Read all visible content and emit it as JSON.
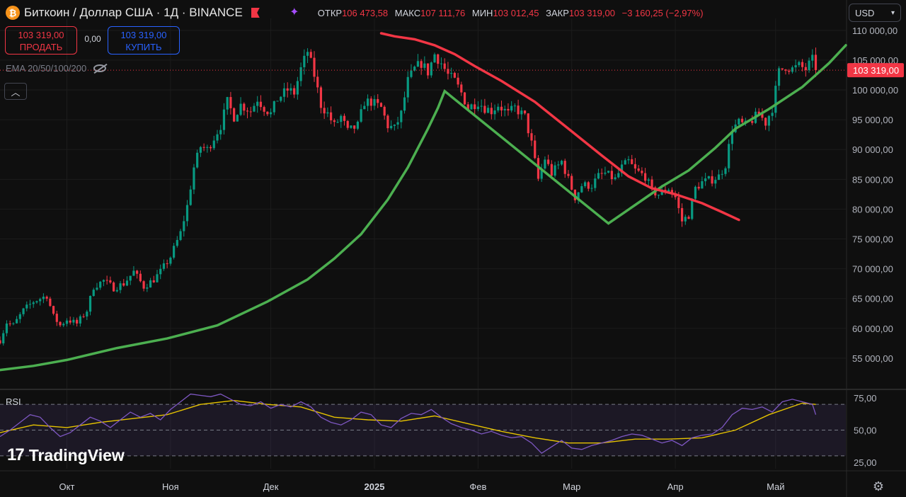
{
  "header": {
    "coin_letter": "₿",
    "title": "Биткоин / Доллар США · 1Д · BINANCE",
    "open_label": "ОТКР",
    "open_value": "106 473,58",
    "high_label": "МАКС",
    "high_value": "107 111,76",
    "low_label": "МИН",
    "low_value": "103 012,45",
    "close_label": "ЗАКР",
    "close_value": "103 319,00",
    "change_value": "−3 160,25 (−2,97%)",
    "currency": "USD"
  },
  "trade": {
    "sell_price": "103 319,00",
    "sell_label": "ПРОДАТЬ",
    "spread": "0,00",
    "buy_price": "103 319,00",
    "buy_label": "КУПИТЬ"
  },
  "indicator_label": "EMA 20/50/100/200",
  "rsi_label": "RSI",
  "logo_text": "TradingView",
  "colors": {
    "up": "#089981",
    "down": "#f23645",
    "ema_red": "#f23645",
    "ema_green": "#4caf50",
    "rsi": "#7e57c2",
    "rsi_ma": "#e6c300",
    "bg": "#0f0f0f"
  },
  "chart_data": {
    "type": "candlestick",
    "symbol": "BTCUSD",
    "y_axis": {
      "ticks": [
        55000,
        60000,
        65000,
        70000,
        75000,
        80000,
        85000,
        90000,
        95000,
        100000,
        105000,
        110000
      ],
      "tick_labels": [
        "55 000,00",
        "60 000,00",
        "65 000,00",
        "70 000,00",
        "75 000,00",
        "80 000,00",
        "85 000,00",
        "90 000,00",
        "95 000,00",
        "100 000,00",
        "105 000,00",
        "110 000,00"
      ],
      "range": [
        50000,
        112000
      ]
    },
    "x_axis": {
      "labels": [
        "Окт",
        "Ноя",
        "Дек",
        "2025",
        "Фев",
        "Мар",
        "Апр",
        "Май"
      ],
      "label_days": [
        0,
        31,
        61,
        92,
        123,
        151,
        182,
        212
      ],
      "range_days": [
        -20,
        233
      ],
      "first_day_date": "2024-10-01"
    },
    "last_price": 103319.0,
    "last_price_label": "103 319,00",
    "path_points": [
      [
        -20,
        58000
      ],
      [
        -18,
        61000
      ],
      [
        -16,
        60500
      ],
      [
        -13,
        63000
      ],
      [
        -10,
        64500
      ],
      [
        -6,
        65500
      ],
      [
        -4,
        62000
      ],
      [
        -2,
        60500
      ],
      [
        0,
        61500
      ],
      [
        3,
        60800
      ],
      [
        6,
        63000
      ],
      [
        8,
        67000
      ],
      [
        11,
        68000
      ],
      [
        14,
        66800
      ],
      [
        17,
        67500
      ],
      [
        20,
        69500
      ],
      [
        23,
        67000
      ],
      [
        26,
        68200
      ],
      [
        28,
        69500
      ],
      [
        31,
        72000
      ],
      [
        34,
        76000
      ],
      [
        36,
        80500
      ],
      [
        38,
        87000
      ],
      [
        40,
        90500
      ],
      [
        42,
        90000
      ],
      [
        44,
        92000
      ],
      [
        46,
        94000
      ],
      [
        48,
        98000
      ],
      [
        50,
        95500
      ],
      [
        52,
        97500
      ],
      [
        55,
        96500
      ],
      [
        57,
        98500
      ],
      [
        59,
        97000
      ],
      [
        61,
        96000
      ],
      [
        63,
        98500
      ],
      [
        66,
        100000
      ],
      [
        68,
        99500
      ],
      [
        70,
        103500
      ],
      [
        72,
        106500
      ],
      [
        74,
        102500
      ],
      [
        76,
        97500
      ],
      [
        78,
        96000
      ],
      [
        80,
        94000
      ],
      [
        82,
        95500
      ],
      [
        84,
        93000
      ],
      [
        87,
        94000
      ],
      [
        89,
        98000
      ],
      [
        91,
        98000
      ],
      [
        94,
        97000
      ],
      [
        96,
        94000
      ],
      [
        98,
        93500
      ],
      [
        100,
        96000
      ],
      [
        102,
        101500
      ],
      [
        104,
        103500
      ],
      [
        106,
        104500
      ],
      [
        108,
        103000
      ],
      [
        110,
        106000
      ],
      [
        112,
        104500
      ],
      [
        114,
        102500
      ],
      [
        116,
        101500
      ],
      [
        118,
        99500
      ],
      [
        120,
        97000
      ],
      [
        123,
        98000
      ],
      [
        125,
        97000
      ],
      [
        127,
        96500
      ],
      [
        129,
        97500
      ],
      [
        132,
        96000
      ],
      [
        134,
        97000
      ],
      [
        137,
        95500
      ],
      [
        139,
        91000
      ],
      [
        141,
        85000
      ],
      [
        143,
        88500
      ],
      [
        145,
        86000
      ],
      [
        148,
        88000
      ],
      [
        150,
        85000
      ],
      [
        152,
        82000
      ],
      [
        154,
        84000
      ],
      [
        157,
        84000
      ],
      [
        159,
        85500
      ],
      [
        161,
        86000
      ],
      [
        164,
        85000
      ],
      [
        166,
        87000
      ],
      [
        168,
        88000
      ],
      [
        170,
        86500
      ],
      [
        173,
        85500
      ],
      [
        175,
        83000
      ],
      [
        177,
        82500
      ],
      [
        180,
        83500
      ],
      [
        182,
        82000
      ],
      [
        184,
        78000
      ],
      [
        186,
        79000
      ],
      [
        188,
        83500
      ],
      [
        190,
        84500
      ],
      [
        193,
        85000
      ],
      [
        195,
        85500
      ],
      [
        197,
        87500
      ],
      [
        199,
        93500
      ],
      [
        201,
        94500
      ],
      [
        203,
        94000
      ],
      [
        205,
        95000
      ],
      [
        207,
        96000
      ],
      [
        209,
        94500
      ],
      [
        211,
        97000
      ],
      [
        213,
        103000
      ],
      [
        215,
        104000
      ],
      [
        217,
        103500
      ],
      [
        219,
        104000
      ],
      [
        221,
        103500
      ],
      [
        223,
        105000
      ],
      [
        224,
        103319
      ]
    ],
    "ema_red": [
      [
        94,
        109500
      ],
      [
        98,
        109000
      ],
      [
        104,
        108500
      ],
      [
        110,
        107500
      ],
      [
        116,
        106000
      ],
      [
        122,
        104000
      ],
      [
        130,
        101500
      ],
      [
        140,
        98000
      ],
      [
        150,
        93500
      ],
      [
        160,
        89000
      ],
      [
        168,
        85500
      ],
      [
        175,
        83500
      ],
      [
        182,
        82500
      ],
      [
        190,
        81000
      ],
      [
        196,
        79500
      ],
      [
        201,
        78200
      ]
    ],
    "ema_green": [
      [
        -20,
        53000
      ],
      [
        -10,
        53700
      ],
      [
        0,
        54700
      ],
      [
        15,
        56700
      ],
      [
        30,
        58300
      ],
      [
        45,
        60500
      ],
      [
        60,
        64500
      ],
      [
        72,
        68200
      ],
      [
        80,
        71700
      ],
      [
        88,
        75800
      ],
      [
        96,
        81600
      ],
      [
        102,
        87000
      ],
      [
        108,
        93500
      ],
      [
        111,
        97000
      ],
      [
        113,
        99800
      ],
      [
        162,
        77600
      ],
      [
        170,
        80700
      ],
      [
        178,
        83800
      ],
      [
        186,
        86500
      ],
      [
        194,
        90300
      ],
      [
        200,
        93500
      ],
      [
        210,
        96800
      ],
      [
        220,
        100500
      ],
      [
        228,
        104500
      ],
      [
        233,
        107500
      ]
    ],
    "rsi": {
      "ticks": [
        25,
        50,
        75
      ],
      "tick_labels": [
        "25,00",
        "50,00",
        "75,00"
      ],
      "range": [
        20,
        80
      ],
      "overbought": 70,
      "oversold": 30,
      "values": [
        [
          -20,
          45
        ],
        [
          -17,
          50
        ],
        [
          -14,
          56
        ],
        [
          -11,
          62
        ],
        [
          -8,
          60
        ],
        [
          -5,
          52
        ],
        [
          -2,
          45
        ],
        [
          1,
          48
        ],
        [
          4,
          54
        ],
        [
          7,
          60
        ],
        [
          10,
          57
        ],
        [
          13,
          52
        ],
        [
          16,
          58
        ],
        [
          19,
          64
        ],
        [
          22,
          60
        ],
        [
          25,
          63
        ],
        [
          28,
          58
        ],
        [
          31,
          66
        ],
        [
          34,
          72
        ],
        [
          37,
          78
        ],
        [
          40,
          77
        ],
        [
          43,
          76
        ],
        [
          46,
          78
        ],
        [
          49,
          74
        ],
        [
          52,
          70
        ],
        [
          55,
          69
        ],
        [
          58,
          72
        ],
        [
          61,
          67
        ],
        [
          64,
          70
        ],
        [
          67,
          68
        ],
        [
          70,
          72
        ],
        [
          73,
          68
        ],
        [
          76,
          60
        ],
        [
          79,
          56
        ],
        [
          82,
          54
        ],
        [
          85,
          58
        ],
        [
          88,
          64
        ],
        [
          91,
          62
        ],
        [
          94,
          54
        ],
        [
          97,
          52
        ],
        [
          100,
          59
        ],
        [
          103,
          63
        ],
        [
          106,
          62
        ],
        [
          109,
          66
        ],
        [
          112,
          60
        ],
        [
          115,
          55
        ],
        [
          118,
          52
        ],
        [
          121,
          50
        ],
        [
          124,
          47
        ],
        [
          127,
          49
        ],
        [
          130,
          46
        ],
        [
          133,
          44
        ],
        [
          136,
          45
        ],
        [
          139,
          40
        ],
        [
          142,
          32
        ],
        [
          145,
          37
        ],
        [
          148,
          42
        ],
        [
          151,
          36
        ],
        [
          154,
          35
        ],
        [
          157,
          38
        ],
        [
          160,
          40
        ],
        [
          163,
          42
        ],
        [
          166,
          45
        ],
        [
          169,
          47
        ],
        [
          172,
          46
        ],
        [
          175,
          43
        ],
        [
          178,
          40
        ],
        [
          181,
          42
        ],
        [
          184,
          38
        ],
        [
          187,
          44
        ],
        [
          190,
          46
        ],
        [
          193,
          47
        ],
        [
          196,
          52
        ],
        [
          199,
          62
        ],
        [
          202,
          67
        ],
        [
          205,
          66
        ],
        [
          208,
          68
        ],
        [
          211,
          64
        ],
        [
          214,
          72
        ],
        [
          217,
          74
        ],
        [
          220,
          72
        ],
        [
          223,
          70
        ],
        [
          224,
          62
        ]
      ],
      "ma_values": [
        [
          -20,
          48
        ],
        [
          -10,
          54
        ],
        [
          0,
          52
        ],
        [
          10,
          56
        ],
        [
          20,
          59
        ],
        [
          30,
          62
        ],
        [
          40,
          70
        ],
        [
          50,
          73
        ],
        [
          60,
          70
        ],
        [
          70,
          68
        ],
        [
          80,
          60
        ],
        [
          90,
          58
        ],
        [
          100,
          57
        ],
        [
          110,
          61
        ],
        [
          120,
          55
        ],
        [
          130,
          49
        ],
        [
          140,
          44
        ],
        [
          150,
          40
        ],
        [
          160,
          40
        ],
        [
          170,
          43
        ],
        [
          180,
          43
        ],
        [
          190,
          44
        ],
        [
          200,
          50
        ],
        [
          210,
          62
        ],
        [
          220,
          71
        ],
        [
          224,
          70
        ]
      ]
    }
  }
}
